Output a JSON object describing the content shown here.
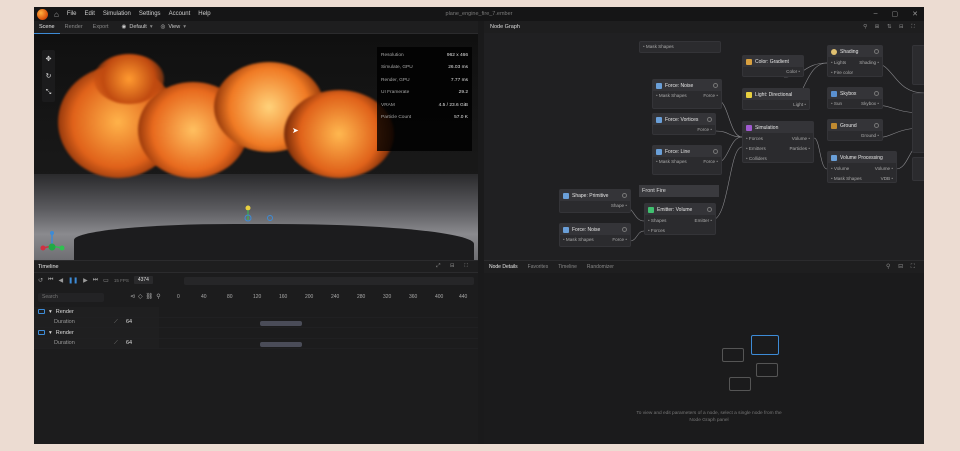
{
  "app": {
    "window_title": "plane_engine_fire_7.ember",
    "menu": [
      "File",
      "Edit",
      "Simulation",
      "Settings",
      "Account",
      "Help"
    ]
  },
  "viewport": {
    "tabs": [
      "Scene",
      "Render",
      "Export"
    ],
    "active_tab": "Scene",
    "camera_label": "Default",
    "view_label": "View",
    "stats": [
      {
        "label": "Resolution",
        "value": "962 x 466"
      },
      {
        "label": "Simulate, GPU",
        "value": "26.03 ms"
      },
      {
        "label": "Render, GPU",
        "value": "7.77 ms"
      },
      {
        "label": "UI Framerate",
        "value": "29.2"
      },
      {
        "label": "VRAM",
        "value": "4.5 / 23.6 GiB"
      },
      {
        "label": "Particle Count",
        "value": "57.0 K"
      }
    ]
  },
  "timeline": {
    "title": "Timeline",
    "fps": "15 FPS",
    "frame": "4374",
    "search_placeholder": "Search",
    "ruler": [
      "0",
      "40",
      "80",
      "120",
      "160",
      "200",
      "240",
      "280",
      "320",
      "360",
      "400",
      "440"
    ],
    "tracks": [
      {
        "name": "Render",
        "sub": "Duration",
        "value": "64"
      },
      {
        "name": "Render",
        "sub": "Duration",
        "value": "64"
      }
    ]
  },
  "nodegraph": {
    "title": "Node Graph",
    "frame_label": "Front Fire",
    "nodes": {
      "mask_top": {
        "row": "Mask Shapes"
      },
      "noise1": {
        "title": "Force: Noise",
        "in": "Mask Shapes",
        "out": "Force"
      },
      "vortices": {
        "title": "Force: Vortices",
        "out": "Force"
      },
      "line": {
        "title": "Force: Line",
        "in": "Mask Shapes",
        "out": "Force"
      },
      "gradient": {
        "title": "Color: Gradient",
        "out": "Color"
      },
      "light": {
        "title": "Light: Directional",
        "out": "Light"
      },
      "simulation": {
        "title": "Simulation",
        "rows": [
          [
            "Forces",
            "Volume"
          ],
          [
            "Emitters",
            "Particles"
          ],
          [
            "Colliders",
            ""
          ]
        ]
      },
      "shading": {
        "title": "Shading",
        "rows": [
          [
            "Lights",
            "Shading"
          ],
          [
            "Fire color",
            ""
          ]
        ]
      },
      "skybox": {
        "title": "Skybox",
        "rows": [
          [
            "Sun",
            "Skybox"
          ]
        ]
      },
      "ground": {
        "title": "Ground",
        "out": "Ground"
      },
      "volume": {
        "title": "Volume Processing",
        "rows": [
          [
            "Volume",
            "Volume"
          ],
          [
            "Mask Shapes",
            "VDB"
          ]
        ]
      },
      "primitive": {
        "title": "Shape: Primitive",
        "out": "Shape"
      },
      "emitter": {
        "title": "Emitter: Volume",
        "rows": [
          [
            "Shapes",
            "Emitter"
          ],
          [
            "Forces",
            ""
          ]
        ]
      },
      "noise2": {
        "title": "Force: Noise",
        "in": "Mask Shapes",
        "out": "Force"
      }
    }
  },
  "nodedetails": {
    "tabs": [
      "Node Details",
      "Favorites",
      "Timeline",
      "Randomizer"
    ],
    "active_tab": "Node Details",
    "message": "To view and edit parameters of a node, select a single node from the Node Graph panel"
  }
}
